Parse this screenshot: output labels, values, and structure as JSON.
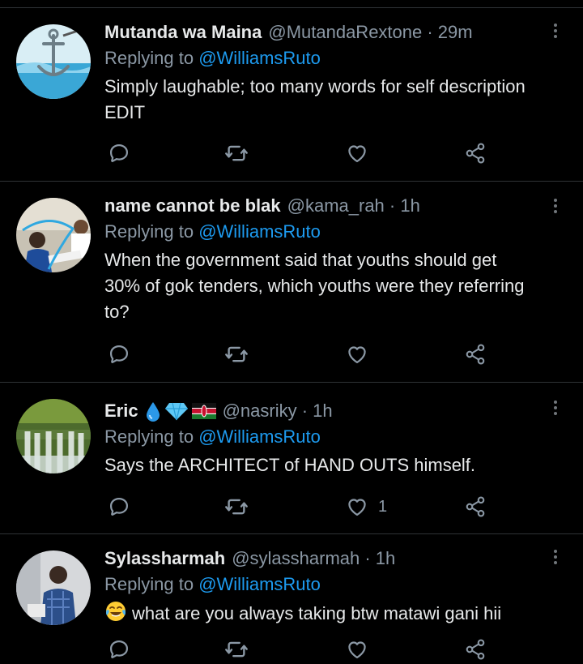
{
  "colors": {
    "background": "#000000",
    "text": "#e7e9ea",
    "muted": "#8b98a5",
    "link": "#1d9bf0",
    "divider": "#2f3336"
  },
  "tweets": [
    {
      "name": "Mutanda wa Maina",
      "meta": "@MutandaRextone · 29m",
      "reply_prefix": "Replying to ",
      "reply_handle": "@WilliamsRuto",
      "body_lines": [
        "Simply laughable; too many words for self description",
        "EDIT"
      ],
      "like_count": "",
      "icons": [
        "reply-icon",
        "retweet-icon",
        "like-icon",
        "share-icon"
      ]
    },
    {
      "name": "name cannot be blak",
      "meta": "@kama_rah · 1h",
      "reply_prefix": "Replying to ",
      "reply_handle": "@WilliamsRuto",
      "body_lines": [
        "When the government said that youths should get",
        "30% of gok tenders, which youths were they referring",
        "to?"
      ],
      "like_count": "",
      "icons": [
        "reply-icon",
        "retweet-icon",
        "like-icon",
        "share-icon"
      ]
    },
    {
      "name": "Eric",
      "meta": "@nasriky · 1h",
      "name_emojis": [
        "droplet-emoji",
        "gem-emoji",
        "kenya-flag-emoji"
      ],
      "reply_prefix": "Replying to ",
      "reply_handle": "@WilliamsRuto",
      "body_lines": [
        "Says the ARCHITECT of HAND OUTS himself."
      ],
      "like_count": "1",
      "icons": [
        "reply-icon",
        "retweet-icon",
        "like-icon",
        "share-icon"
      ]
    },
    {
      "name": "Sylassharmah",
      "meta": "@sylassharmah · 1h",
      "reply_prefix": "Replying to ",
      "reply_handle": "@WilliamsRuto",
      "body_lines": [
        "what are you always taking btw matawi gani hii"
      ],
      "body_emoji": "tears-of-joy-emoji",
      "like_count": "",
      "icons": [
        "reply-icon",
        "retweet-icon",
        "like-icon",
        "share-icon"
      ]
    }
  ]
}
